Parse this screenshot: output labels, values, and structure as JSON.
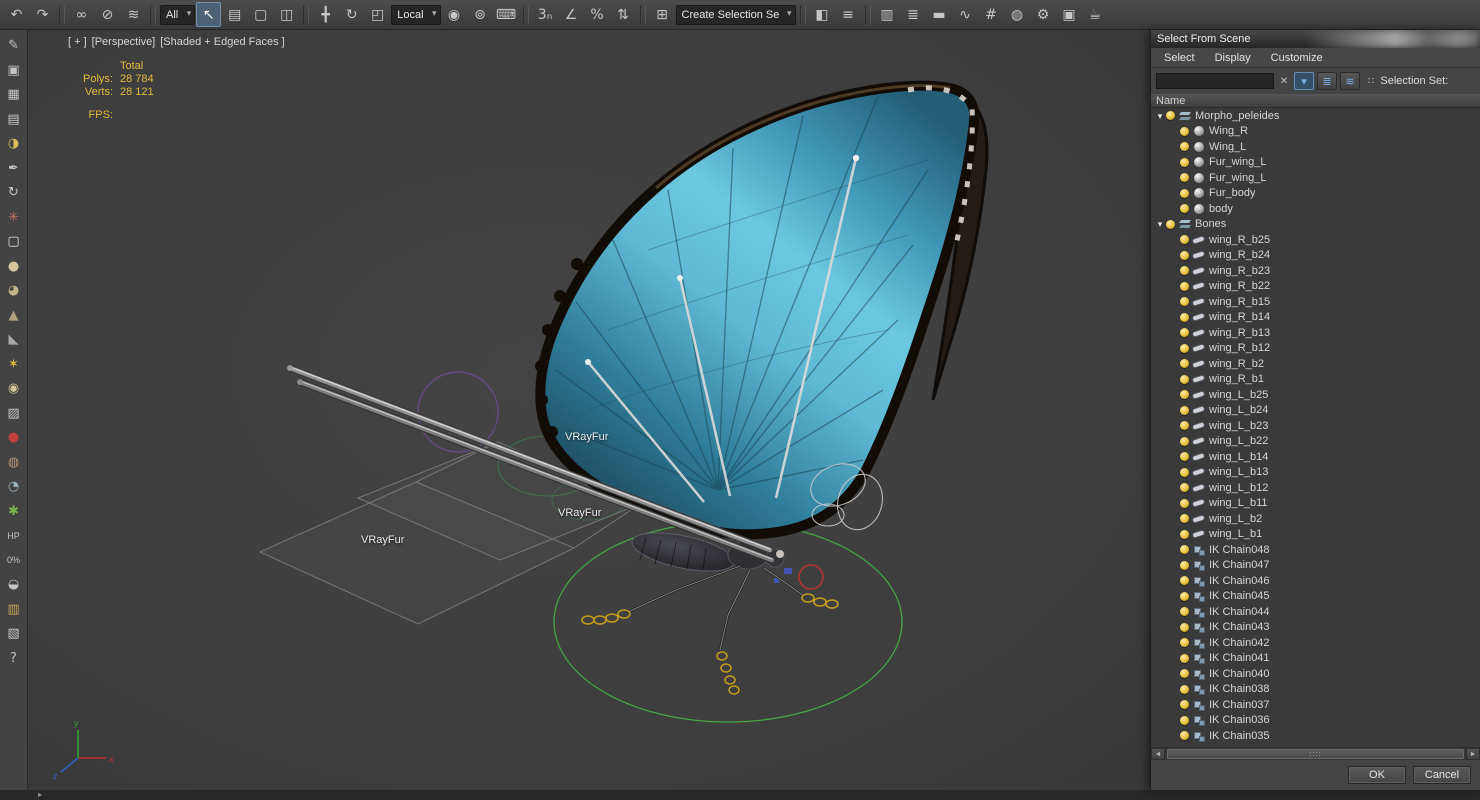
{
  "toolbar": {
    "items": [
      {
        "name": "undo-button",
        "glyph": "↶"
      },
      {
        "name": "redo-button",
        "glyph": "↷"
      },
      {
        "name": "toolbar-separator",
        "type": "sep"
      },
      {
        "name": "select-and-link-button",
        "glyph": "∞"
      },
      {
        "name": "unlink-selection-button",
        "glyph": "⊘"
      },
      {
        "name": "bind-to-space-warp-button",
        "glyph": "≋"
      },
      {
        "name": "toolbar-separator",
        "type": "sep"
      },
      {
        "name": "selection-filter-dropdown",
        "type": "dropdown",
        "value": "All"
      },
      {
        "name": "select-object-button",
        "glyph": "↖",
        "active": true
      },
      {
        "name": "select-by-name-button",
        "glyph": "▤"
      },
      {
        "name": "rectangular-selection-region-button",
        "glyph": "▢"
      },
      {
        "name": "window-crossing-button",
        "glyph": "◫"
      },
      {
        "name": "toolbar-separator",
        "type": "sep"
      },
      {
        "name": "select-and-move-button",
        "glyph": "╋"
      },
      {
        "name": "select-and-rotate-button",
        "glyph": "↻"
      },
      {
        "name": "select-and-scale-button",
        "glyph": "◰"
      },
      {
        "name": "reference-coordinate-dropdown",
        "type": "dropdown",
        "value": "Local"
      },
      {
        "name": "use-pivot-point-button",
        "glyph": "◉"
      },
      {
        "name": "select-and-manipulate-button",
        "glyph": "⊚"
      },
      {
        "name": "keyboard-shortcut-override-button",
        "glyph": "⌨"
      },
      {
        "name": "toolbar-separator",
        "type": "sep"
      },
      {
        "name": "snaps-toggle-button",
        "glyph": "3ₙ"
      },
      {
        "name": "angle-snap-button",
        "glyph": "∠"
      },
      {
        "name": "percent-snap-button",
        "glyph": "%"
      },
      {
        "name": "spinner-snap-button",
        "glyph": "⇅"
      },
      {
        "name": "toolbar-separator",
        "type": "sep"
      },
      {
        "name": "edit-named-selections-button",
        "glyph": "⊞"
      },
      {
        "name": "named-selection-set-field",
        "type": "dropdown",
        "value": "Create Selection Se"
      },
      {
        "name": "toolbar-separator",
        "type": "sep"
      },
      {
        "name": "mirror-button",
        "glyph": "◧"
      },
      {
        "name": "align-button",
        "glyph": "≡"
      },
      {
        "name": "toolbar-separator",
        "type": "sep"
      },
      {
        "name": "toggle-scene-explorer-button",
        "glyph": "▥"
      },
      {
        "name": "toggle-layer-explorer-button",
        "glyph": "≣"
      },
      {
        "name": "toggle-ribbon-button",
        "glyph": "▬"
      },
      {
        "name": "curve-editor-button",
        "glyph": "∿"
      },
      {
        "name": "schematic-view-button",
        "glyph": "#"
      },
      {
        "name": "material-editor-button",
        "glyph": "◍"
      },
      {
        "name": "render-setup-button",
        "glyph": "⚙"
      },
      {
        "name": "rendered-frame-button",
        "glyph": "▣"
      },
      {
        "name": "render-production-button",
        "glyph": "☕"
      }
    ]
  },
  "left_toolbar": {
    "items": [
      {
        "name": "pencil-tool-icon",
        "glyph": "✎"
      },
      {
        "name": "panel-tool-icon",
        "glyph": "▣"
      },
      {
        "name": "grid-tool-icon",
        "glyph": "▦"
      },
      {
        "name": "table-tool-icon",
        "glyph": "▤"
      },
      {
        "name": "lamp-tool-icon",
        "glyph": "◑",
        "color": "#d8c05a"
      },
      {
        "name": "pen-tool-icon",
        "glyph": "✒"
      },
      {
        "name": "rotate-tool-icon",
        "glyph": "↻"
      },
      {
        "name": "burst-tool-icon",
        "glyph": "✳",
        "color": "#c87060"
      },
      {
        "name": "square-tool-icon",
        "glyph": "▢",
        "color": "#e0e0e0"
      },
      {
        "name": "sphere-tool-icon",
        "glyph": "●",
        "color": "#d6c6a0"
      },
      {
        "name": "circle-tool-icon",
        "glyph": "◕",
        "color": "#c4b48c"
      },
      {
        "name": "cone-tool-icon",
        "glyph": "▲",
        "color": "#b0a080"
      },
      {
        "name": "wedge-tool-icon",
        "glyph": "◣",
        "color": "#a8a8a8"
      },
      {
        "name": "sun-tool-icon",
        "glyph": "✶",
        "color": "#e4c040"
      },
      {
        "name": "ball-tool-icon",
        "glyph": "◉",
        "color": "#d0c098"
      },
      {
        "name": "pattern-tool-icon",
        "glyph": "▨"
      },
      {
        "name": "red-ball-tool-icon",
        "glyph": "●",
        "color": "#c04040"
      },
      {
        "name": "vase-tool-icon",
        "glyph": "◍",
        "color": "#b89878"
      },
      {
        "name": "disc-tool-icon",
        "glyph": "◔",
        "color": "#9fb6c0"
      },
      {
        "name": "leaf-tool-icon",
        "glyph": "✱",
        "color": "#7ab648"
      },
      {
        "name": "hp-tool-icon",
        "glyph": "HP",
        "small": true
      },
      {
        "name": "percent-tool-icon",
        "glyph": "0%",
        "small": true
      },
      {
        "name": "half-disc-tool-icon",
        "glyph": "◒"
      },
      {
        "name": "palette-tool-icon",
        "glyph": "▥",
        "color": "#c8a858"
      },
      {
        "name": "hatch-tool-icon",
        "glyph": "▧"
      },
      {
        "name": "help-tool-icon",
        "glyph": "?"
      }
    ]
  },
  "viewport": {
    "labels": {
      "general": "[ + ]",
      "pov": "[Perspective]",
      "shading": "[Shaded + Edged Faces ]"
    },
    "stats": {
      "total": "Total",
      "polys_label": "Polys:",
      "polys": "28 784",
      "verts_label": "Verts:",
      "verts": "28 121",
      "fps_label": "FPS:"
    },
    "fur_labels": [
      "VRayFur",
      "VRayFur",
      "VRayFur"
    ]
  },
  "dialog": {
    "title": "Select From Scene",
    "menus": [
      {
        "name": "menu-select",
        "label": "Select"
      },
      {
        "name": "menu-display",
        "label": "Display"
      },
      {
        "name": "menu-customize",
        "label": "Customize"
      }
    ],
    "search_value": "",
    "selection_set_label": "Selection Set:",
    "columns": {
      "name": "Name"
    },
    "tree": [
      {
        "label": "Morpho_peleides",
        "type": "group",
        "level": 0
      },
      {
        "label": "Wing_R",
        "type": "geometry",
        "level": 1
      },
      {
        "label": "Wing_L",
        "type": "geometry",
        "level": 1
      },
      {
        "label": "Fur_wing_L",
        "type": "geometry",
        "level": 1
      },
      {
        "label": "Fur_wing_L",
        "type": "geometry",
        "level": 1
      },
      {
        "label": "Fur_body",
        "type": "geometry",
        "level": 1
      },
      {
        "label": "body",
        "type": "geometry",
        "level": 1
      },
      {
        "label": "Bones",
        "type": "group",
        "level": 0
      },
      {
        "label": "wing_R_b25",
        "type": "bone",
        "level": 1
      },
      {
        "label": "wing_R_b24",
        "type": "bone",
        "level": 1
      },
      {
        "label": "wing_R_b23",
        "type": "bone",
        "level": 1
      },
      {
        "label": "wing_R_b22",
        "type": "bone",
        "level": 1
      },
      {
        "label": "wing_R_b15",
        "type": "bone",
        "level": 1
      },
      {
        "label": "wing_R_b14",
        "type": "bone",
        "level": 1
      },
      {
        "label": "wing_R_b13",
        "type": "bone",
        "level": 1
      },
      {
        "label": "wing_R_b12",
        "type": "bone",
        "level": 1
      },
      {
        "label": "wing_R_b2",
        "type": "bone",
        "level": 1
      },
      {
        "label": "wing_R_b1",
        "type": "bone",
        "level": 1
      },
      {
        "label": "wing_L_b25",
        "type": "bone",
        "level": 1
      },
      {
        "label": "wing_L_b24",
        "type": "bone",
        "level": 1
      },
      {
        "label": "wing_L_b23",
        "type": "bone",
        "level": 1
      },
      {
        "label": "wing_L_b22",
        "type": "bone",
        "level": 1
      },
      {
        "label": "wing_L_b14",
        "type": "bone",
        "level": 1
      },
      {
        "label": "wing_L_b13",
        "type": "bone",
        "level": 1
      },
      {
        "label": "wing_L_b12",
        "type": "bone",
        "level": 1
      },
      {
        "label": "wing_L_b11",
        "type": "bone",
        "level": 1
      },
      {
        "label": "wing_L_b2",
        "type": "bone",
        "level": 1
      },
      {
        "label": "wing_L_b1",
        "type": "bone",
        "level": 1
      },
      {
        "label": "IK Chain048",
        "type": "ik",
        "level": 1
      },
      {
        "label": "IK Chain047",
        "type": "ik",
        "level": 1
      },
      {
        "label": "IK Chain046",
        "type": "ik",
        "level": 1
      },
      {
        "label": "IK Chain045",
        "type": "ik",
        "level": 1
      },
      {
        "label": "IK Chain044",
        "type": "ik",
        "level": 1
      },
      {
        "label": "IK Chain043",
        "type": "ik",
        "level": 1
      },
      {
        "label": "IK Chain042",
        "type": "ik",
        "level": 1
      },
      {
        "label": "IK Chain041",
        "type": "ik",
        "level": 1
      },
      {
        "label": "IK Chain040",
        "type": "ik",
        "level": 1
      },
      {
        "label": "IK Chain038",
        "type": "ik",
        "level": 1
      },
      {
        "label": "IK Chain037",
        "type": "ik",
        "level": 1
      },
      {
        "label": "IK Chain036",
        "type": "ik",
        "level": 1
      },
      {
        "label": "IK Chain035",
        "type": "ik",
        "level": 1
      }
    ],
    "ok": "OK",
    "cancel": "Cancel"
  }
}
